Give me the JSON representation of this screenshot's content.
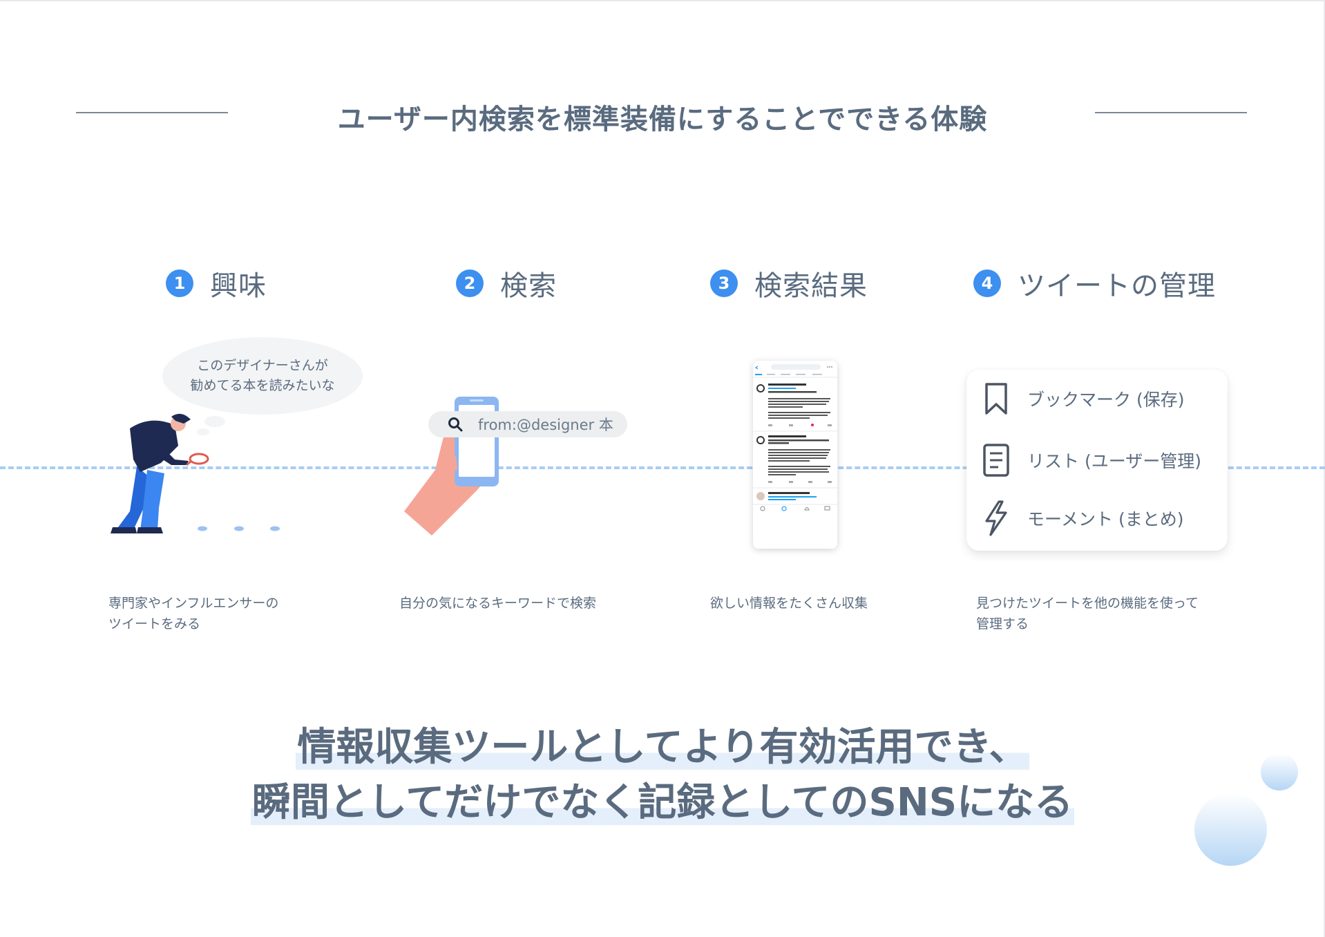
{
  "section_title": "ユーザー内検索を標準装備にすることでできる体験",
  "steps": [
    {
      "num": "1",
      "title": "興味",
      "desc_line1": "専門家やインフルエンサーの",
      "desc_line2": "ツイートをみる"
    },
    {
      "num": "2",
      "title": "検索",
      "desc_line1": "自分の気になるキーワードで検索",
      "desc_line2": ""
    },
    {
      "num": "3",
      "title": "検索結果",
      "desc_line1": "欲しい情報をたくさん収集",
      "desc_line2": ""
    },
    {
      "num": "4",
      "title": "ツイートの管理",
      "desc_line1": "見つけたツイートを他の機能を使って",
      "desc_line2": "管理する"
    }
  ],
  "bubble": {
    "line1": "このデザイナーさんが",
    "line2": "勧めてる本を読みたいな"
  },
  "search_query": "from:@designer 本",
  "manage_card": {
    "items": [
      {
        "icon": "bookmark-icon",
        "label": "ブックマーク (保存)"
      },
      {
        "icon": "list-icon",
        "label": "リスト (ユーザー管理)"
      },
      {
        "icon": "lightning-icon",
        "label": "モーメント (まとめ)"
      }
    ]
  },
  "conclusion": {
    "line1": "情報収集ツールとしてより有効活用でき、",
    "line2": "瞬間としてだけでなく記録としてのSNSになる"
  },
  "colors": {
    "accent": "#3d8ff0",
    "text": "#5a6b7f",
    "dash": "#a8cdf2",
    "highlight": "#e4effb"
  }
}
